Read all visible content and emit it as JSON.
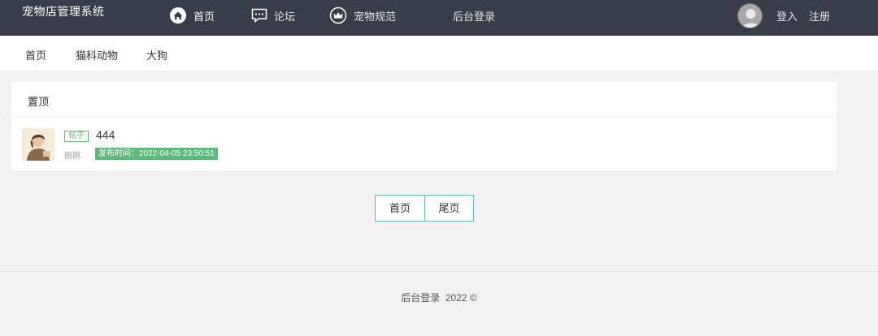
{
  "header": {
    "brand": "宠物店管理系统",
    "nav": [
      {
        "label": "首页",
        "icon": "home-icon"
      },
      {
        "label": "论坛",
        "icon": "chat-icon"
      },
      {
        "label": "宠物规范",
        "icon": "crown-icon"
      },
      {
        "label": "后台登录"
      }
    ],
    "login": "登入",
    "register": "注册"
  },
  "subnav": [
    "首页",
    "猫科动物",
    "大狗"
  ],
  "card": {
    "title": "置顶",
    "post": {
      "tag": "帖子",
      "title": "444",
      "relative_time": "刚刚",
      "publish_time": "发布时间：2022-04-05 23:50:51"
    }
  },
  "pager": {
    "first": "首页",
    "last": "尾页"
  },
  "footer": {
    "text": "后台登录  2022 ©"
  },
  "colors": {
    "header_bg": "#393d49",
    "accent": "#5fb878",
    "pager_border": "#5fb8b4"
  }
}
